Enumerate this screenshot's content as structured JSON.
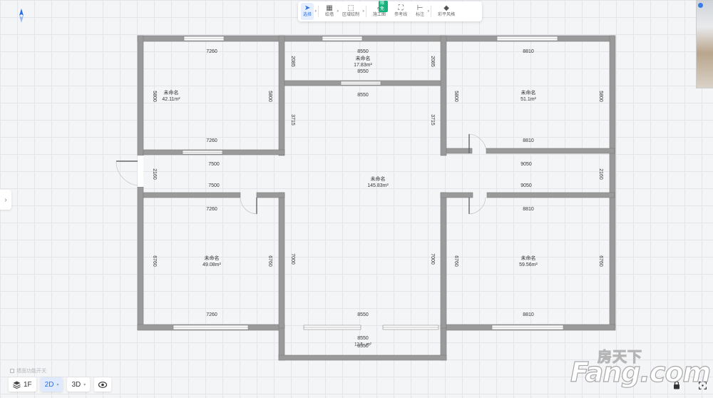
{
  "toolbar": {
    "items": [
      {
        "label": "选择",
        "icon": "cursor-icon"
      },
      {
        "label": "绘墙",
        "icon": "draw-wall-icon"
      },
      {
        "label": "区域绘制",
        "icon": "area-draw-icon"
      },
      {
        "label": "施工图",
        "icon": "construction-drawing-icon",
        "badge": "限免"
      },
      {
        "label": "参考线",
        "icon": "guide-line-icon"
      },
      {
        "label": "标注",
        "icon": "annotation-icon"
      },
      {
        "label": "彩平风格",
        "icon": "paint-bucket-icon"
      }
    ]
  },
  "floorplan": {
    "rooms": [
      {
        "name": "未命名",
        "area": "42.11m²"
      },
      {
        "name": "未命名",
        "area": "17.83m²"
      },
      {
        "name": "未命名",
        "area": "51.1m²"
      },
      {
        "name": "未命名",
        "area": "145.83m²"
      },
      {
        "name": "未命名",
        "area": "49.08m²"
      },
      {
        "name": "未命名",
        "area": "59.56m²"
      },
      {
        "name": "",
        "area": "12.5...m²"
      }
    ],
    "dimensions": {
      "tl_top": "7260",
      "tl_bottom": "7260",
      "tl_left": "5800",
      "tl_right": "5800",
      "tc_top": "8550",
      "tc_bottom": "8550",
      "tc_left": "2085",
      "tc_right": "2085",
      "tr_top": "8810",
      "tr_bottom": "8810",
      "tr_left": "5800",
      "tr_right": "5800",
      "c_top": "8550",
      "c_left": "3715",
      "c_right": "3715",
      "c_left_vertical_lower": "7000",
      "c_right_vertical_lower": "7000",
      "c_bottom": "8550",
      "cl_top": "7500",
      "cl_bottom": "7500",
      "cl_left": "2160",
      "cr_top": "9050",
      "cr_bottom": "9050",
      "cr_right": "2160",
      "bl_top": "7260",
      "bl_bottom": "7260",
      "bl_left": "6760",
      "bl_right": "6760",
      "br_top": "8810",
      "br_bottom": "8810",
      "br_left": "6760",
      "br_right": "6760",
      "balcony_top": "8550",
      "balcony_bottom": "8550"
    }
  },
  "hint": "墙面功能开关",
  "bottom": {
    "floor_label": "1F",
    "mode_2d": "2D",
    "mode_3d": "3D"
  },
  "watermark": {
    "cn": "房天下",
    "en": "Fang.com"
  },
  "colors": {
    "accent": "#2b6fe6",
    "badge": "#14b37d",
    "wall": "#7d7d7d",
    "wall_fill": "#9a9a9a"
  }
}
